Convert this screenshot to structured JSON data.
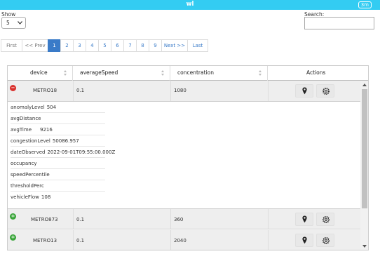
{
  "app": {
    "title": "wl",
    "badge": "3m"
  },
  "controls": {
    "show_label": "Show",
    "show_value": "5",
    "search_label": "Search:",
    "search_value": ""
  },
  "pagination": {
    "first": "First",
    "prev": "<< Prev",
    "pages": [
      "1",
      "2",
      "3",
      "4",
      "5",
      "6",
      "7",
      "8",
      "9"
    ],
    "active": "1",
    "next": "Next >>",
    "last": "Last"
  },
  "table": {
    "columns": [
      "device",
      "averageSpeed",
      "concentration",
      "Actions"
    ],
    "rows": [
      {
        "device": "METRO18",
        "averageSpeed": "0.1",
        "concentration": "1080",
        "expanded": true
      },
      {
        "device": "METRO873",
        "averageSpeed": "0.1",
        "concentration": "360",
        "expanded": false
      },
      {
        "device": "METRO13",
        "averageSpeed": "0.1",
        "concentration": "2040",
        "expanded": false
      }
    ],
    "detail": [
      {
        "key": "anomalyLevel",
        "value": "504"
      },
      {
        "key": "avgDistance",
        "value": ""
      },
      {
        "key": "avgTime",
        "value": "9216"
      },
      {
        "key": "congestionLevel",
        "value": "50086.957"
      },
      {
        "key": "dateObserved",
        "value": "2022-09-01T09:55:00.000Z"
      },
      {
        "key": "occupancy",
        "value": ""
      },
      {
        "key": "speedPercentile",
        "value": ""
      },
      {
        "key": "thresholdPerc",
        "value": ""
      },
      {
        "key": "vehicleFlow",
        "value": "108"
      }
    ]
  },
  "icons": {
    "collapse": "minus-circle-icon",
    "expand": "plus-circle-icon",
    "location": "map-marker-icon",
    "settings": "gear-icon"
  },
  "colors": {
    "titlebar": "#33ccf2",
    "page_active": "#3a7bc8",
    "collapse": "#d9302c",
    "expand": "#3aa53a"
  }
}
